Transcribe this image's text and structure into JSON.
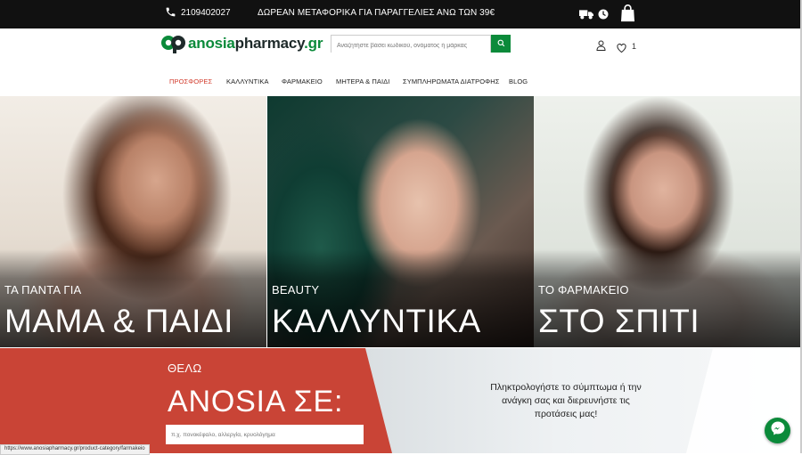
{
  "topbar": {
    "phone": "2109402027",
    "promo": "ΔΩΡΕΑΝ ΜΕΤΑΦΟΡΙΚΑ ΓΙΑ ΠΑΡΑΓΓΕΛΙΕΣ ΑΝΩ ΤΩΝ 39€",
    "icons": [
      "phone-icon",
      "truck-icon",
      "clock-icon",
      "shopping-bag-icon"
    ]
  },
  "header": {
    "logo_part1": "anosia",
    "logo_part2": "pharmacy",
    "logo_part3": ".gr",
    "search_placeholder": "Αναζητήστε βάσει κωδικού, ονόματος ή μάρκας",
    "wishlist_count": "1"
  },
  "nav": {
    "items": [
      {
        "label": "ΠΡΟΣΦΟΡΕΣ",
        "active": true
      },
      {
        "label": "ΚΑΛΛΥΝΤΙΚΑ"
      },
      {
        "label": "ΦΑΡΜΑΚΕΙΟ"
      },
      {
        "label": "ΜΗΤΕΡΑ & ΠΑΙΔΙ"
      },
      {
        "label": "ΣΥΜΠΛΗΡΩΜΑΤΑ ΔΙΑΤΡΟΦΗΣ"
      },
      {
        "label": "BLOG"
      }
    ]
  },
  "panels": [
    {
      "small": "ΤΑ ΠΑΝΤΑ ΓΙΑ",
      "big": "ΜΑΜΑ & ΠΑΙΔΙ"
    },
    {
      "small": "BEAUTY",
      "big": "ΚΑΛΛΥΝΤΙΚΑ"
    },
    {
      "small": "ΤΟ ΦΑΡΜΑΚΕΙΟ",
      "big": "ΣΤΟ ΣΠΙΤΙ"
    }
  ],
  "banner": {
    "kicker": "ΘΕΛΩ",
    "title": "ANOSIA ΣΕ:",
    "input_placeholder": "π.χ. πονοκέφαλο, αλλεργία, κρυολόγημα",
    "hint": "Πληκτρολογήστε το σύμπτωμα ή την ανάγκη σας και διερευνήστε τις προτάσεις μας!"
  },
  "status_url": "https://www.anosiapharmacy.gr/product-category/farmakeio",
  "colors": {
    "brand_green": "#0b8a3a",
    "active_nav": "#d23b2c",
    "banner_red": "#c94436",
    "topbar": "#111111"
  }
}
